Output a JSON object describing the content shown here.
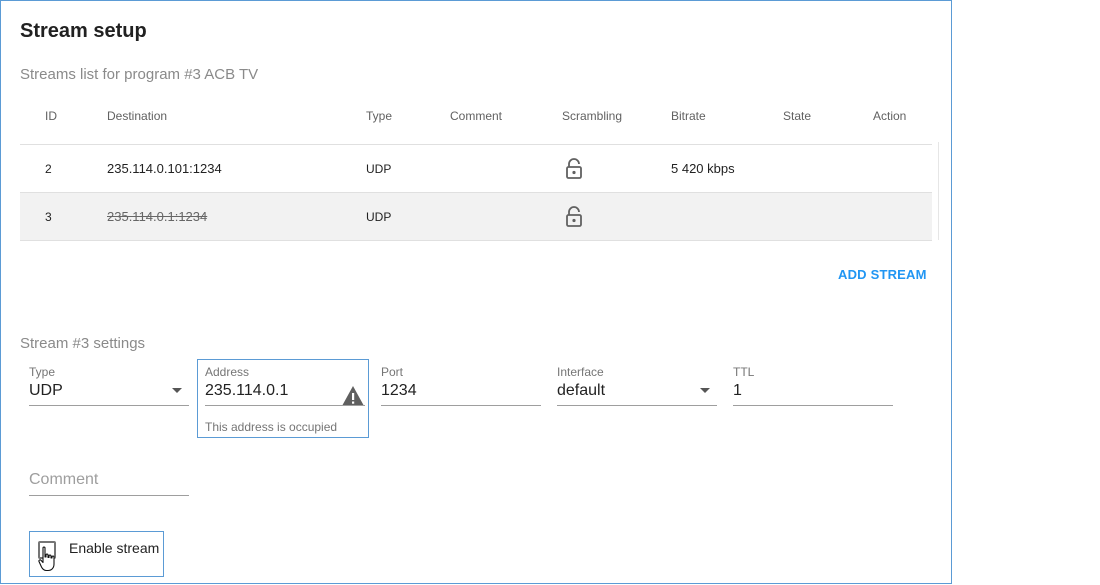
{
  "page": {
    "title": "Stream setup",
    "subtitle": "Streams list for program #3 ACB TV"
  },
  "table": {
    "headers": {
      "id": "ID",
      "destination": "Destination",
      "type": "Type",
      "comment": "Comment",
      "scrambling": "Scrambling",
      "bitrate": "Bitrate",
      "state": "State",
      "action": "Action"
    },
    "rows": [
      {
        "id": "2",
        "destination": "235.114.0.101:1234",
        "type": "UDP",
        "comment": "",
        "scrambling_icon": "lock-open-icon",
        "bitrate": "5 420 kbps",
        "state": "",
        "action": ""
      },
      {
        "id": "3",
        "destination": "235.114.0.1:1234",
        "type": "UDP",
        "comment": "",
        "scrambling_icon": "lock-open-icon",
        "bitrate": "",
        "state": "",
        "action": "",
        "disabled": true
      }
    ]
  },
  "add_stream_label": "ADD STREAM",
  "settings": {
    "title": "Stream #3 settings",
    "type": {
      "label": "Type",
      "value": "UDP"
    },
    "address": {
      "label": "Address",
      "value": "235.114.0.1",
      "helper": "This address is occupied"
    },
    "port": {
      "label": "Port",
      "value": "1234"
    },
    "interface": {
      "label": "Interface",
      "value": "default"
    },
    "ttl": {
      "label": "TTL",
      "value": "1"
    },
    "comment": {
      "placeholder": "Comment",
      "value": ""
    },
    "enable": {
      "label": "Enable stream",
      "checked": false
    }
  },
  "colors": {
    "accent": "#2196f3",
    "focus_border": "#5b9bd5",
    "selected_row": "#f2f2f2"
  }
}
